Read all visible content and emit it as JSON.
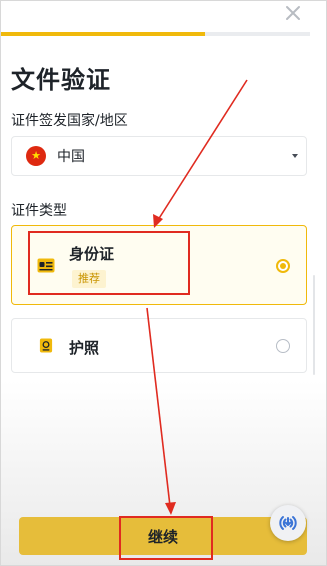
{
  "header": {
    "close_icon": "close-icon",
    "progress": 0.66
  },
  "page": {
    "title": "文件验证"
  },
  "country": {
    "label": "证件签发国家/地区",
    "selected": "中国",
    "flag_icon": "china-flag-icon",
    "flag_star": "★"
  },
  "doc_type": {
    "label": "证件类型",
    "options": [
      {
        "name": "身份证",
        "badge": "推荐",
        "selected": true,
        "icon": "id-card-icon"
      },
      {
        "name": "护照",
        "selected": false,
        "icon": "passport-icon"
      }
    ]
  },
  "footer": {
    "continue_label": "继续",
    "help_icon": "broadcast-help-icon"
  },
  "colors": {
    "accent": "#f0b90b",
    "button": "#e6bd3a",
    "annotation": "#e02b20"
  }
}
